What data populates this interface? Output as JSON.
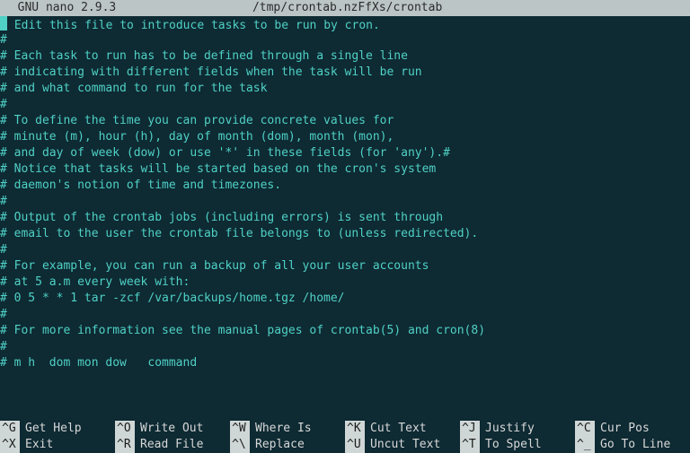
{
  "titlebar": {
    "product": "  GNU nano 2.9.3",
    "filepath": "/tmp/crontab.nzFfXs/crontab"
  },
  "lines": [
    " Edit this file to introduce tasks to be run by cron.",
    "",
    " Each task to run has to be defined through a single line",
    " indicating with different fields when the task will be run",
    " and what command to run for the task",
    "",
    " To define the time you can provide concrete values for",
    " minute (m), hour (h), day of month (dom), month (mon),",
    " and day of week (dow) or use '*' in these fields (for 'any').#",
    " Notice that tasks will be started based on the cron's system",
    " daemon's notion of time and timezones.",
    "",
    " Output of the crontab jobs (including errors) is sent through",
    " email to the user the crontab file belongs to (unless redirected).",
    "",
    " For example, you can run a backup of all your user accounts",
    " at 5 a.m every week with:",
    " 0 5 * * 1 tar -zcf /var/backups/home.tgz /home/",
    "",
    " For more information see the manual pages of crontab(5) and cron(8)",
    "",
    " m h  dom mon dow   command"
  ],
  "help": {
    "row1": [
      {
        "key": "^G",
        "label": "Get Help"
      },
      {
        "key": "^O",
        "label": "Write Out"
      },
      {
        "key": "^W",
        "label": "Where Is"
      },
      {
        "key": "^K",
        "label": "Cut Text"
      },
      {
        "key": "^J",
        "label": "Justify"
      },
      {
        "key": "^C",
        "label": "Cur Pos"
      }
    ],
    "row2": [
      {
        "key": "^X",
        "label": "Exit"
      },
      {
        "key": "^R",
        "label": "Read File"
      },
      {
        "key": "^\\",
        "label": "Replace"
      },
      {
        "key": "^U",
        "label": "Uncut Text"
      },
      {
        "key": "^T",
        "label": "To Spell"
      },
      {
        "key": "^_",
        "label": "Go To Line"
      }
    ]
  }
}
